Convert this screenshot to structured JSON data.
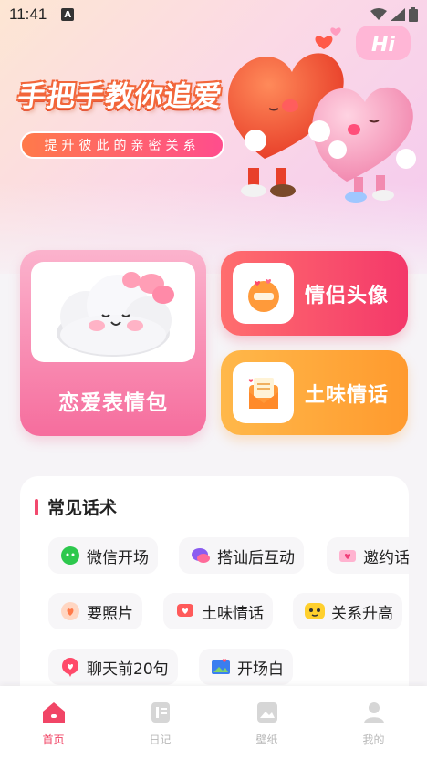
{
  "status_bar": {
    "time": "11:41",
    "notification_badge": "A"
  },
  "hero": {
    "title": "手把手教你追爱",
    "subtitle": "提升彼此的亲密关系",
    "art_text": "Hi"
  },
  "features": {
    "big_card": {
      "label": "恋爱表情包",
      "icon": "cloud-mascot-icon"
    },
    "small_cards": [
      {
        "label": "情侣头像",
        "icon": "couple-avatar-icon",
        "color": "#f4386a"
      },
      {
        "label": "土味情话",
        "icon": "love-letter-icon",
        "color": "#ff9a2e"
      }
    ]
  },
  "phrases": {
    "title": "常见话术",
    "chips": [
      {
        "label": "微信开场",
        "icon": "wechat-icon"
      },
      {
        "label": "搭讪后互动",
        "icon": "chat-bubble-icon"
      },
      {
        "label": "邀约话",
        "icon": "invite-icon"
      },
      {
        "label": "要照片",
        "icon": "photo-request-icon"
      },
      {
        "label": "土味情话",
        "icon": "love-chat-icon"
      },
      {
        "label": "关系升高",
        "icon": "emoji-icon"
      },
      {
        "label": "聊天前20句",
        "icon": "heart-pin-icon"
      },
      {
        "label": "开场白",
        "icon": "picture-icon"
      }
    ]
  },
  "tabbar": {
    "tabs": [
      {
        "label": "首页",
        "icon": "home-icon",
        "active": true
      },
      {
        "label": "日记",
        "icon": "diary-icon",
        "active": false
      },
      {
        "label": "壁纸",
        "icon": "wallpaper-icon",
        "active": false
      },
      {
        "label": "我的",
        "icon": "profile-icon",
        "active": false
      }
    ]
  },
  "colors": {
    "accent": "#f14566",
    "card_pink": "#f66d9d",
    "card_red": "#f4386a",
    "card_orange": "#ff9a2e"
  }
}
